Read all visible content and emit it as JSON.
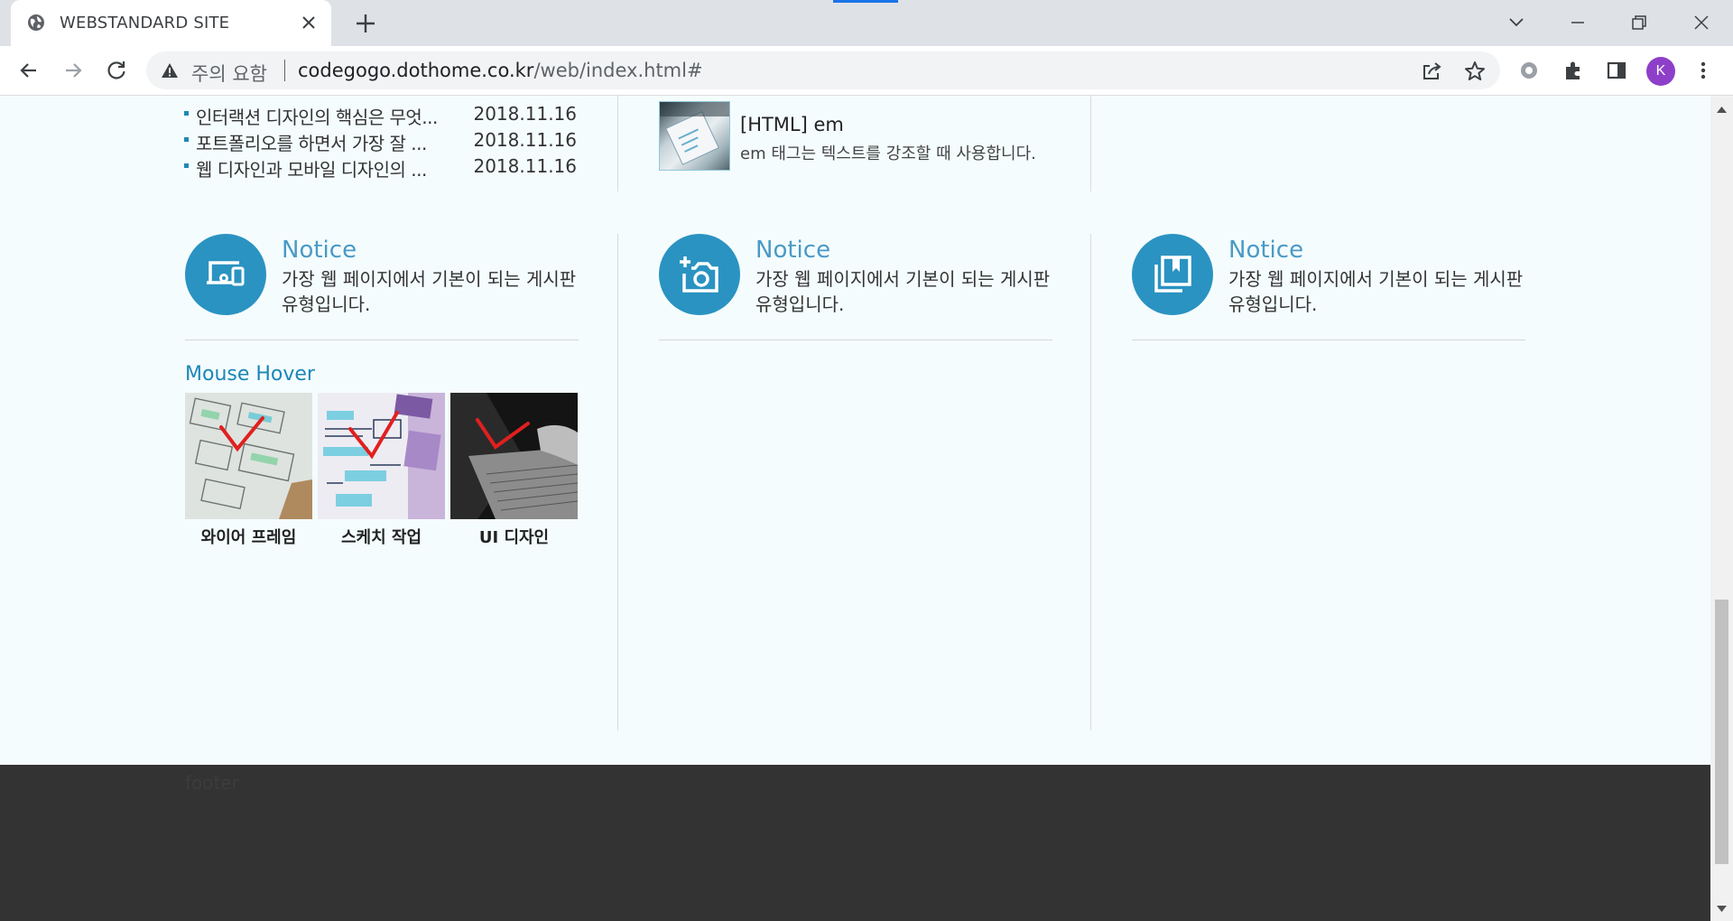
{
  "browser": {
    "tab_title": "WEBSTANDARD SITE",
    "security_label": "주의 요함",
    "url_domain": "codegogo.dothome.co.kr",
    "url_path": "/web/index.html#",
    "profile_initial": "K"
  },
  "news": {
    "items": [
      {
        "title": "인터랙션 디자인의 핵심은 무엇...",
        "date": "2018.11.16"
      },
      {
        "title": "포트폴리오를 하면서 가장 잘 ...",
        "date": "2018.11.16"
      },
      {
        "title": "웹 디자인과 모바일 디자인의 ...",
        "date": "2018.11.16"
      }
    ]
  },
  "feature": {
    "title": "[HTML] em",
    "description": "em 태그는 텍스트를 강조할 때 사용합니다."
  },
  "notices": [
    {
      "title": "Notice",
      "description": "가장 웹 페이지에서 기본이 되는 게시판 유형입니다.",
      "icon": "devices-icon"
    },
    {
      "title": "Notice",
      "description": "가장 웹 페이지에서 기본이 되는 게시판 유형입니다.",
      "icon": "add-camera-icon"
    },
    {
      "title": "Notice",
      "description": "가장 웹 페이지에서 기본이 되는 게시판 유형입니다.",
      "icon": "library-bookmark-icon"
    }
  ],
  "gallery": {
    "title": "Mouse Hover",
    "items": [
      {
        "caption": "와이어 프레임"
      },
      {
        "caption": "스케치 작업"
      },
      {
        "caption": "UI 디자인"
      }
    ]
  },
  "footer": {
    "text": "footer"
  },
  "colors": {
    "accent": "#2b93c2",
    "page_bg": "#f5fcfd",
    "footer_bg": "#333333"
  }
}
